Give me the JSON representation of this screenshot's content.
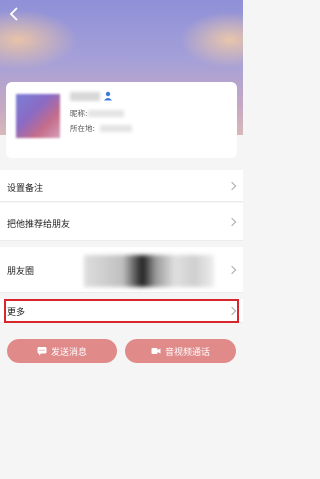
{
  "header": {
    "back_icon": "chevron-left-icon"
  },
  "profile": {
    "nickname_label": "昵称:",
    "location_label": "所在地:",
    "gender_icon": "user-icon",
    "accent_color": "#3a7be0"
  },
  "menu": {
    "remark_label": "设置备注",
    "recommend_label": "把他推荐给朋友",
    "moments_label": "朋友圈",
    "more_label": "更多"
  },
  "actions": {
    "message_label": "发送消息",
    "call_label": "音视频通话",
    "button_color": "#e08a8a"
  },
  "highlight_color": "#d9262c"
}
